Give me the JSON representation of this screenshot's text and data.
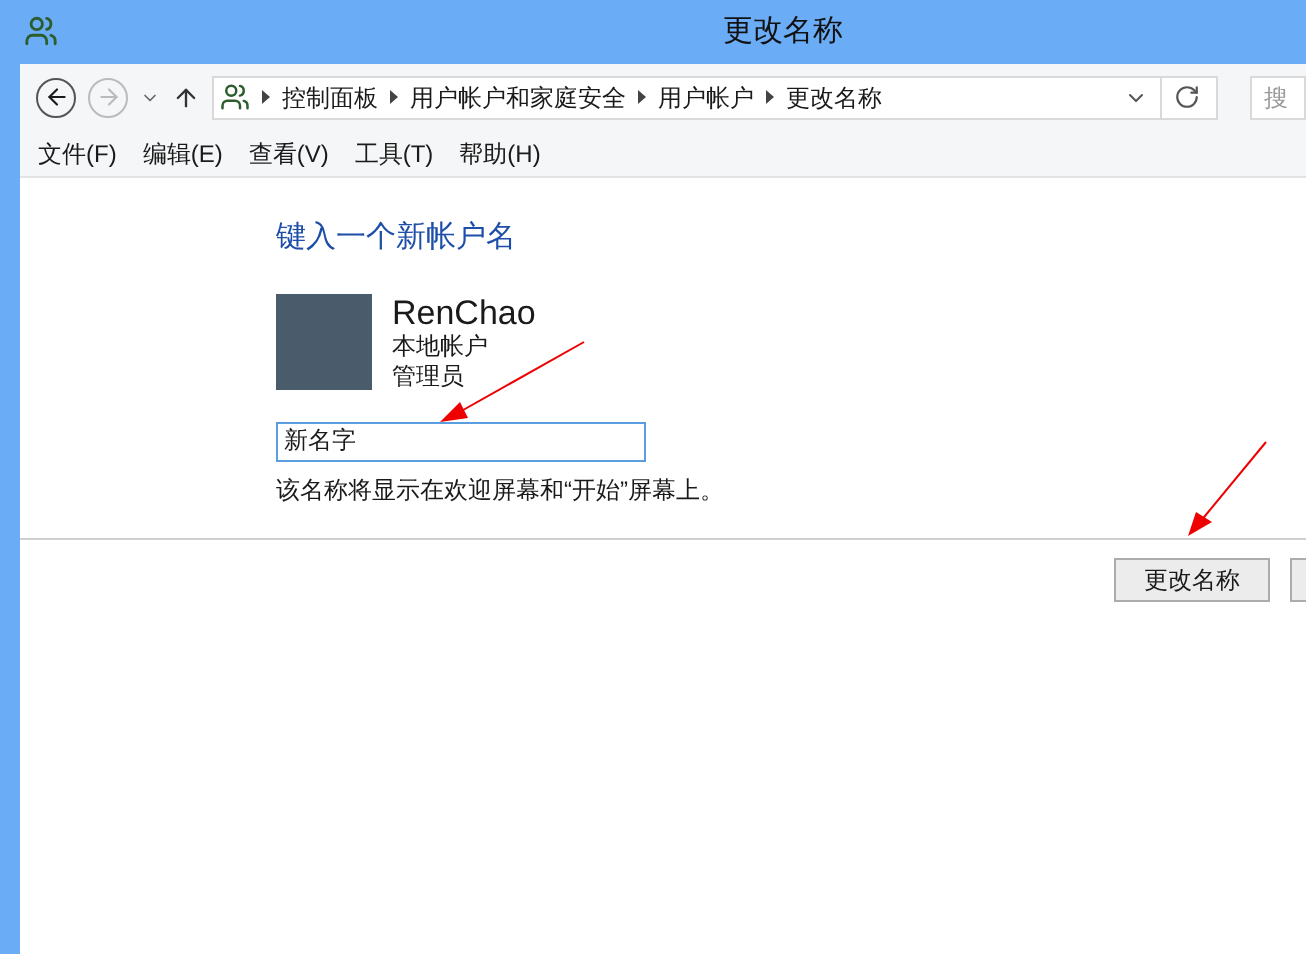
{
  "window": {
    "title": "更改名称"
  },
  "address_bar": {
    "breadcrumbs": [
      "控制面板",
      "用户帐户和家庭安全",
      "用户帐户",
      "更改名称"
    ],
    "search_placeholder": "搜"
  },
  "menu": [
    "文件(F)",
    "编辑(E)",
    "查看(V)",
    "工具(T)",
    "帮助(H)"
  ],
  "content": {
    "heading": "键入一个新帐户名",
    "account": {
      "name": "RenChao",
      "type": "本地帐户",
      "role": "管理员"
    },
    "name_field": {
      "value": "新名字"
    },
    "hint": "该名称将显示在欢迎屏幕和“开始”屏幕上。"
  },
  "buttons": [
    "更改名称"
  ]
}
